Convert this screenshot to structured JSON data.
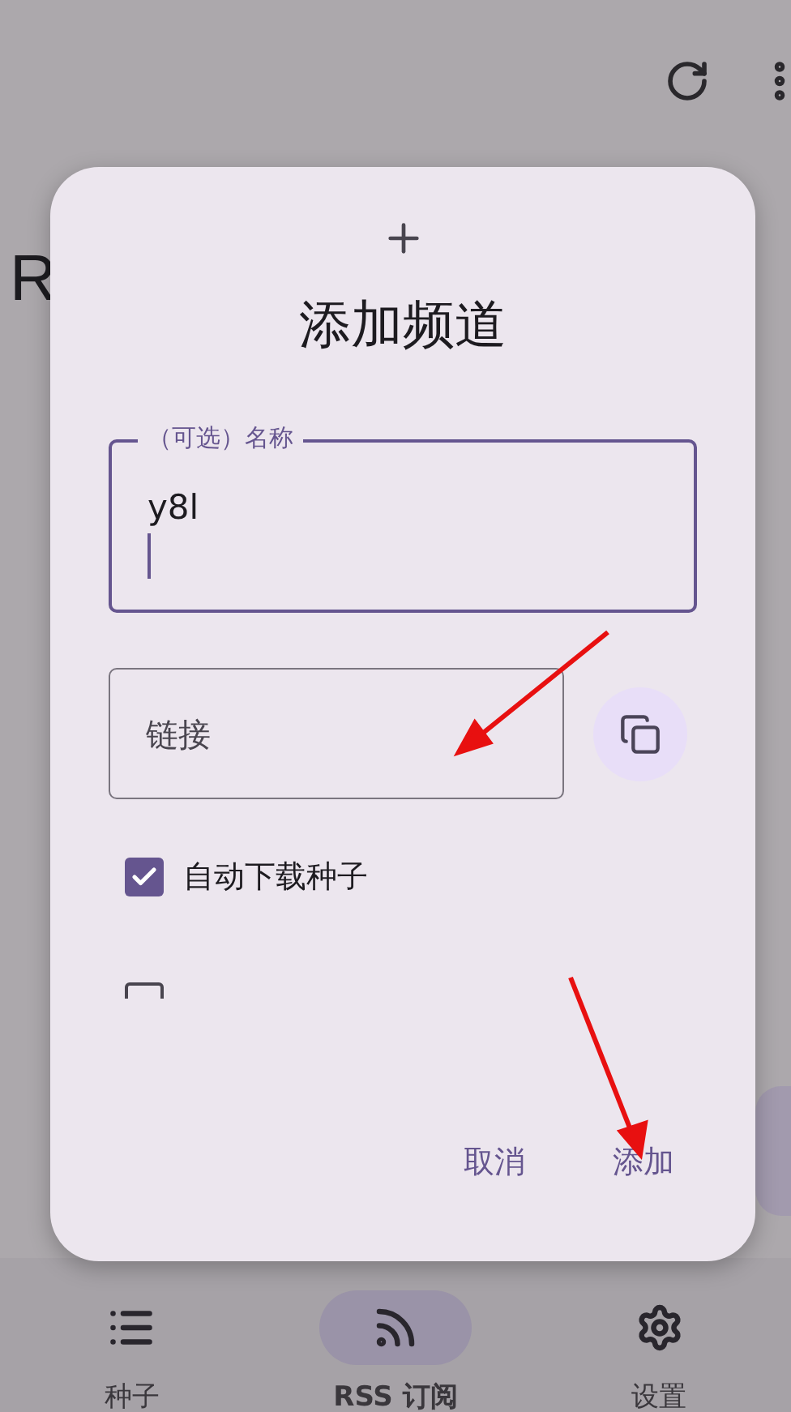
{
  "app_bar": {
    "title": "R"
  },
  "dialog": {
    "title": "添加频道",
    "name_field": {
      "label": "（可选）名称",
      "value": "y8l",
      "focused": true
    },
    "link_field": {
      "placeholder": "链接"
    },
    "options": [
      {
        "label": "自动下载种子",
        "checked": true
      },
      {
        "checked": false
      }
    ],
    "buttons": [
      {
        "label": "取消"
      },
      {
        "label": "添加"
      }
    ]
  },
  "nav": [
    {
      "label": "种子",
      "kind": "list",
      "selected": false
    },
    {
      "label": "RSS 订阅",
      "kind": "rss",
      "selected": true
    },
    {
      "label": "设置",
      "kind": "gear",
      "selected": false
    }
  ]
}
